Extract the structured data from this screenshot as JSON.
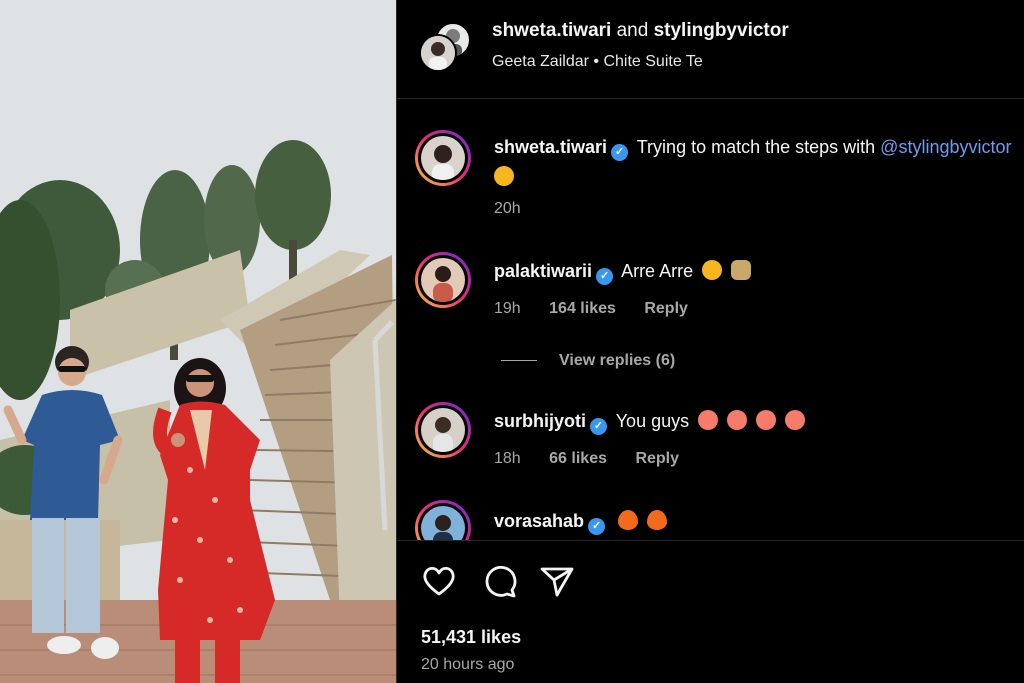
{
  "post": {
    "header": {
      "user1": "shweta.tiwari",
      "connector": "and",
      "user2": "stylingbyvictor",
      "song": "Geeta Zaildar",
      "separator": "•",
      "track": "Chite Suite Te"
    },
    "caption": {
      "username": "shweta.tiwari",
      "text": "Trying to match the steps with ",
      "mention": "@stylingbyvictor",
      "time": "20h"
    },
    "comments": [
      {
        "username": "palaktiwarii",
        "text": "Arre Arre",
        "time": "19h",
        "likes": "164 likes",
        "reply": "Reply",
        "emojis": [
          "pleading-face",
          "folded-hands"
        ]
      },
      {
        "username": "surbhijyoti",
        "text": "You guys",
        "time": "18h",
        "likes": "66 likes",
        "reply": "Reply",
        "emojis": [
          "heart-eyes",
          "heart-eyes",
          "heart-eyes",
          "heart-eyes"
        ]
      },
      {
        "username": "vorasahab",
        "text": "",
        "emojis": [
          "fire",
          "fire"
        ]
      }
    ],
    "view_replies": "View replies (6)",
    "likes": "51,431 likes",
    "posted": "20 hours ago",
    "icons": [
      "heart-icon",
      "comment-icon",
      "share-icon",
      "verified-badge-icon"
    ],
    "colors": {
      "verified": "#3897f0",
      "mention": "#6e9cf2",
      "background": "#000000",
      "meta": "#a8a8a8"
    }
  }
}
